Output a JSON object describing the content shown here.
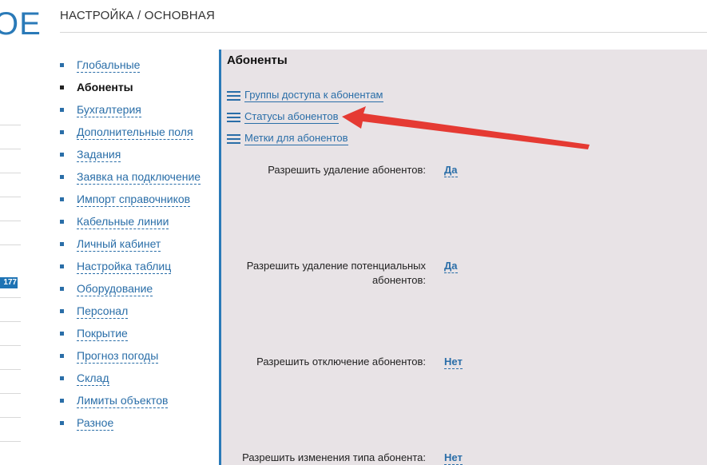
{
  "logo": {
    "text": "OE"
  },
  "sidebar_strip": {
    "badge": "177"
  },
  "breadcrumb": "НАСТРОЙКА / ОСНОВНАЯ",
  "nav": {
    "items": [
      {
        "label": "Глобальные",
        "active": false
      },
      {
        "label": "Абоненты",
        "active": true
      },
      {
        "label": "Бухгалтерия",
        "active": false
      },
      {
        "label": "Дополнительные поля",
        "active": false
      },
      {
        "label": "Задания",
        "active": false
      },
      {
        "label": "Заявка на подключение",
        "active": false
      },
      {
        "label": "Импорт справочников",
        "active": false
      },
      {
        "label": "Кабельные линии",
        "active": false
      },
      {
        "label": "Личный кабинет",
        "active": false
      },
      {
        "label": "Настройка таблиц",
        "active": false
      },
      {
        "label": "Оборудование",
        "active": false
      },
      {
        "label": "Персонал",
        "active": false
      },
      {
        "label": "Покрытие",
        "active": false
      },
      {
        "label": "Прогноз погоды",
        "active": false
      },
      {
        "label": "Склад",
        "active": false
      },
      {
        "label": "Лимиты объектов",
        "active": false
      },
      {
        "label": "Разное",
        "active": false
      }
    ]
  },
  "panel": {
    "title": "Абоненты",
    "links": [
      {
        "label": "Группы доступа к абонентам",
        "icon": "list-icon"
      },
      {
        "label": "Статусы абонентов",
        "icon": "list-icon"
      },
      {
        "label": "Метки для абонентов",
        "icon": "list-icon"
      }
    ],
    "settings": [
      {
        "label_lines": [
          "Разрешить удаление абонентов:"
        ],
        "value": "Да"
      },
      {
        "label_lines": [
          "Разрешить удаление потенциальных",
          "абонентов:"
        ],
        "value": "Да"
      },
      {
        "label_lines": [
          "Разрешить отключение абонентов:"
        ],
        "value": "Нет"
      },
      {
        "label_lines": [
          "Разрешить изменения типа абонента:"
        ],
        "value": "Нет"
      }
    ]
  },
  "colors": {
    "accent": "#2a6ea8",
    "panel_bg": "#e8e3e6",
    "arrow": "#e53a33"
  }
}
